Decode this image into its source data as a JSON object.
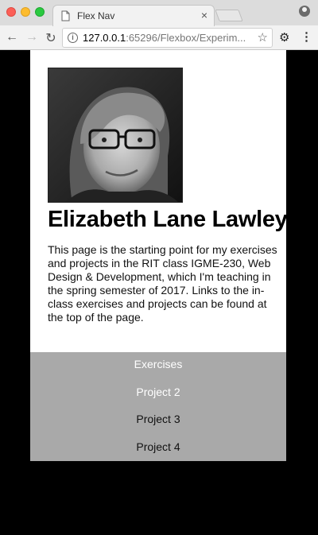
{
  "browser": {
    "tab_title": "Flex Nav",
    "tab_close": "×",
    "url_host": "127.0.0.1",
    "url_rest": ":65296/Flexbox/Experim..."
  },
  "profile": {
    "name": "Elizabeth Lane Lawley",
    "bio": "This page is the starting point for my exercises and projects in the RIT class IGME-230, Web Design & Development, which I'm teaching in the spring semester of 2017. Links to the in-class exercises and projects can be found at the top of the page."
  },
  "nav": {
    "items": [
      {
        "label": "Exercises",
        "color": "#ffffff"
      },
      {
        "label": "Project 2",
        "color": "#ffffff"
      },
      {
        "label": "Project 3",
        "color": "#111111"
      },
      {
        "label": "Project 4",
        "color": "#111111"
      }
    ]
  },
  "colors": {
    "page_bg": "#000000",
    "content_bg": "#ffffff",
    "nav_bg": "#a9a9a9"
  }
}
